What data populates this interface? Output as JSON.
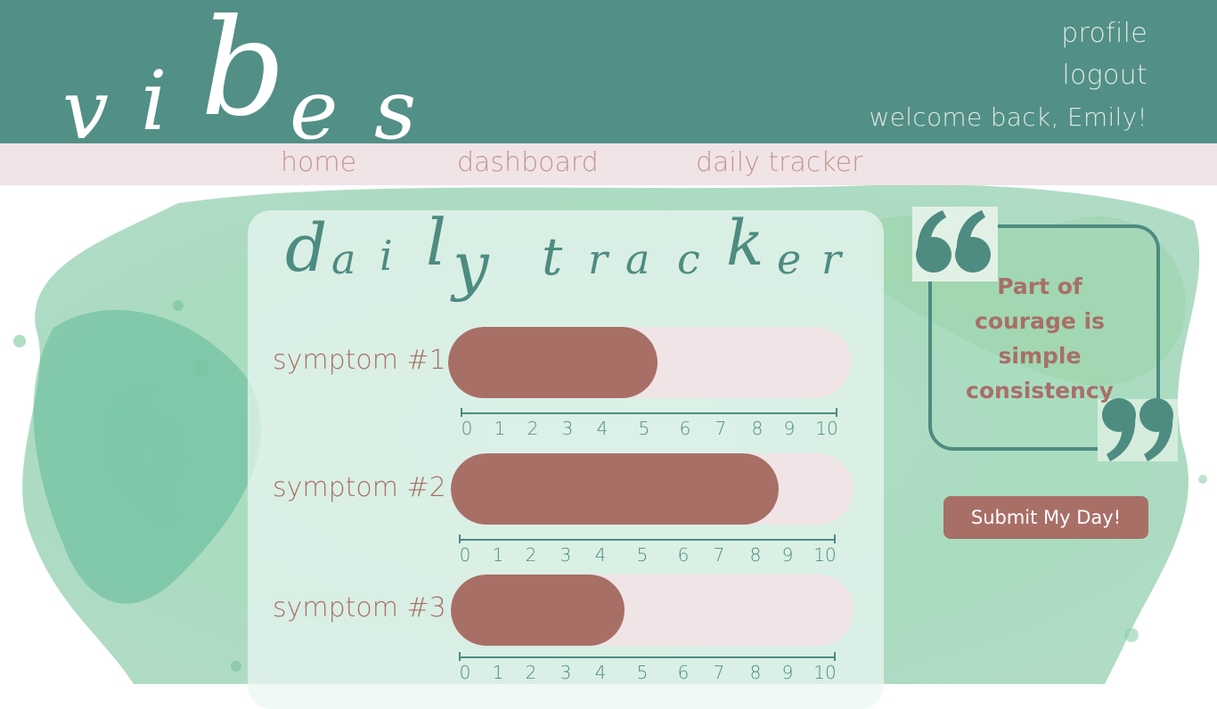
{
  "header": {
    "logo_letters": [
      "v",
      "i",
      "b",
      "e",
      "s"
    ],
    "links": {
      "profile": "profile",
      "logout": "logout"
    },
    "welcome": "welcome back, Emily!"
  },
  "nav": {
    "items": [
      "home",
      "dashboard",
      "daily tracker"
    ]
  },
  "tracker": {
    "title_letters": [
      "d",
      "a",
      "i",
      "l",
      "y",
      "t",
      "r",
      "a",
      "c",
      "k",
      "e",
      "r"
    ],
    "scale_numbers": [
      "0",
      "1",
      "2",
      "3",
      "4",
      "5",
      "6",
      "7",
      "8",
      "9",
      "10"
    ],
    "symptoms": [
      {
        "label": "symptom #1",
        "value": 5.3
      },
      {
        "label": "symptom #2",
        "value": 8.3
      },
      {
        "label": "symptom #3",
        "value": 4.4
      }
    ]
  },
  "quote": {
    "text": "Part of courage is simple consistency"
  },
  "submit": {
    "label": "Submit My Day!"
  },
  "colors": {
    "teal": "#528f86",
    "rose": "#a86f67",
    "blush": "#f1e4e7",
    "green_wash": "#8fd0a8"
  },
  "icons": {
    "open_quote": "open-quote-icon",
    "close_quote": "close-quote-icon"
  }
}
